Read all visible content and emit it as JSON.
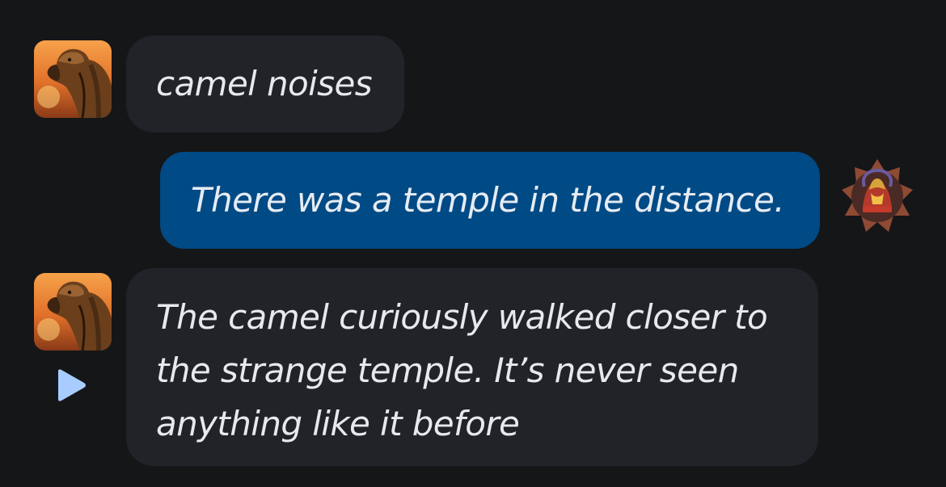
{
  "messages": [
    {
      "sender": "bot",
      "avatar": "camel-avatar",
      "text": "camel noises"
    },
    {
      "sender": "user",
      "avatar": "user-emblem-avatar",
      "text": "There was a temple in the distance."
    },
    {
      "sender": "bot",
      "avatar": "camel-avatar",
      "text": "The camel curiously walked closer to the strange temple. It’s never seen anything like it before"
    }
  ],
  "controls": {
    "play_icon": "play-icon"
  },
  "colors": {
    "background": "#151618",
    "bot_bubble": "#212328",
    "user_bubble": "#004a85",
    "text": "#e8e9ec",
    "play": "#a8ccff"
  }
}
